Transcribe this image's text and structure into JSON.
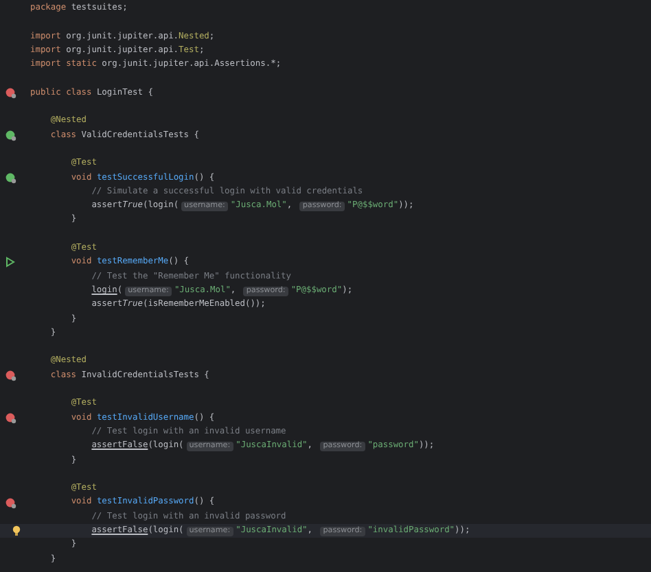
{
  "editor": {
    "lines": [
      {
        "kind": "code",
        "tokens": [
          {
            "kind": "keyword",
            "text": "package "
          },
          {
            "kind": "text",
            "text": "testsuites;"
          }
        ]
      },
      {
        "kind": "blank"
      },
      {
        "kind": "code",
        "tokens": [
          {
            "kind": "keyword",
            "text": "import "
          },
          {
            "kind": "text",
            "text": "org.junit.jupiter.api."
          },
          {
            "kind": "annotation",
            "text": "Nested"
          },
          {
            "kind": "text",
            "text": ";"
          }
        ]
      },
      {
        "kind": "code",
        "tokens": [
          {
            "kind": "keyword",
            "text": "import "
          },
          {
            "kind": "text",
            "text": "org.junit.jupiter.api."
          },
          {
            "kind": "annotation",
            "text": "Test"
          },
          {
            "kind": "text",
            "text": ";"
          }
        ]
      },
      {
        "kind": "code",
        "tokens": [
          {
            "kind": "keyword",
            "text": "import static "
          },
          {
            "kind": "text",
            "text": "org.junit.jupiter.api.Assertions.*;"
          }
        ]
      },
      {
        "kind": "blank"
      },
      {
        "kind": "code",
        "gutter": {
          "kind": "fail"
        },
        "tokens": [
          {
            "kind": "keyword",
            "text": "public class "
          },
          {
            "kind": "text",
            "text": "LoginTest {"
          }
        ]
      },
      {
        "kind": "blank"
      },
      {
        "kind": "code",
        "tokens": [
          {
            "kind": "annotation",
            "text": "    @Nested"
          }
        ]
      },
      {
        "kind": "code",
        "gutter": {
          "kind": "pass"
        },
        "tokens": [
          {
            "kind": "keyword",
            "text": "    class "
          },
          {
            "kind": "text",
            "text": "ValidCredentialsTests {"
          }
        ]
      },
      {
        "kind": "blank"
      },
      {
        "kind": "code",
        "tokens": [
          {
            "kind": "annotation",
            "text": "        @Test"
          }
        ]
      },
      {
        "kind": "code",
        "gutter": {
          "kind": "pass"
        },
        "tokens": [
          {
            "kind": "keyword",
            "text": "        void "
          },
          {
            "kind": "method",
            "text": "testSuccessfulLogin"
          },
          {
            "kind": "text",
            "text": "() {"
          }
        ]
      },
      {
        "kind": "code",
        "tokens": [
          {
            "kind": "comment",
            "text": "            // Simulate a successful login with valid credentials"
          }
        ]
      },
      {
        "kind": "code",
        "tokens": [
          {
            "kind": "text",
            "text": "            assert"
          },
          {
            "kind": "italic",
            "text": "True"
          },
          {
            "kind": "text",
            "text": "(login("
          },
          {
            "kind": "hint",
            "text": "username:"
          },
          {
            "kind": "string",
            "text": "\"Jusca.Mol\""
          },
          {
            "kind": "text",
            "text": ", "
          },
          {
            "kind": "hint",
            "text": "password:"
          },
          {
            "kind": "string",
            "text": "\"P@$$word\""
          },
          {
            "kind": "text",
            "text": "));"
          }
        ]
      },
      {
        "kind": "code",
        "tokens": [
          {
            "kind": "text",
            "text": "        }"
          }
        ]
      },
      {
        "kind": "blank"
      },
      {
        "kind": "code",
        "tokens": [
          {
            "kind": "annotation",
            "text": "        @Test"
          }
        ]
      },
      {
        "kind": "code",
        "gutter": {
          "kind": "run"
        },
        "tokens": [
          {
            "kind": "keyword",
            "text": "        void "
          },
          {
            "kind": "method",
            "text": "testRememberMe"
          },
          {
            "kind": "text",
            "text": "() {"
          }
        ]
      },
      {
        "kind": "code",
        "tokens": [
          {
            "kind": "comment",
            "text": "            // Test the \"Remember Me\" functionality"
          }
        ]
      },
      {
        "kind": "code",
        "tokens": [
          {
            "kind": "underlined",
            "text": "            login"
          },
          {
            "kind": "text",
            "text": "("
          },
          {
            "kind": "hint",
            "text": "username:"
          },
          {
            "kind": "string",
            "text": "\"Jusca.Mol\""
          },
          {
            "kind": "text",
            "text": ", "
          },
          {
            "kind": "hint",
            "text": "password:"
          },
          {
            "kind": "string",
            "text": "\"P@$$word\""
          },
          {
            "kind": "text",
            "text": ");"
          }
        ]
      },
      {
        "kind": "code",
        "tokens": [
          {
            "kind": "text",
            "text": "            assert"
          },
          {
            "kind": "italic",
            "text": "True"
          },
          {
            "kind": "text",
            "text": "(isRememberMeEnabled());"
          }
        ]
      },
      {
        "kind": "code",
        "tokens": [
          {
            "kind": "text",
            "text": "        }"
          }
        ]
      },
      {
        "kind": "code",
        "tokens": [
          {
            "kind": "text",
            "text": "    }"
          }
        ]
      },
      {
        "kind": "blank"
      },
      {
        "kind": "code",
        "tokens": [
          {
            "kind": "annotation",
            "text": "    @Nested"
          }
        ]
      },
      {
        "kind": "code",
        "gutter": {
          "kind": "fail"
        },
        "tokens": [
          {
            "kind": "keyword",
            "text": "    class "
          },
          {
            "kind": "text",
            "text": "InvalidCredentialsTests {"
          }
        ]
      },
      {
        "kind": "blank"
      },
      {
        "kind": "code",
        "tokens": [
          {
            "kind": "annotation",
            "text": "        @Test"
          }
        ]
      },
      {
        "kind": "code",
        "gutter": {
          "kind": "fail"
        },
        "tokens": [
          {
            "kind": "keyword",
            "text": "        void "
          },
          {
            "kind": "method",
            "text": "testInvalidUsername"
          },
          {
            "kind": "text",
            "text": "() {"
          }
        ]
      },
      {
        "kind": "code",
        "tokens": [
          {
            "kind": "comment",
            "text": "            // Test login with an invalid username"
          }
        ]
      },
      {
        "kind": "code",
        "tokens": [
          {
            "kind": "underlined",
            "text": "            assertFalse"
          },
          {
            "kind": "text",
            "text": "(login("
          },
          {
            "kind": "hint",
            "text": "username:"
          },
          {
            "kind": "string",
            "text": "\"JuscaInvalid\""
          },
          {
            "kind": "text",
            "text": ", "
          },
          {
            "kind": "hint",
            "text": "password:"
          },
          {
            "kind": "string",
            "text": "\"password\""
          },
          {
            "kind": "text",
            "text": "));"
          }
        ]
      },
      {
        "kind": "code",
        "tokens": [
          {
            "kind": "text",
            "text": "        }"
          }
        ]
      },
      {
        "kind": "blank"
      },
      {
        "kind": "code",
        "tokens": [
          {
            "kind": "annotation",
            "text": "        @Test"
          }
        ]
      },
      {
        "kind": "code",
        "gutter": {
          "kind": "fail"
        },
        "tokens": [
          {
            "kind": "keyword",
            "text": "        void "
          },
          {
            "kind": "method",
            "text": "testInvalidPassword"
          },
          {
            "kind": "text",
            "text": "() {"
          }
        ]
      },
      {
        "kind": "code",
        "tokens": [
          {
            "kind": "comment",
            "text": "            // Test login with an invalid password"
          }
        ]
      },
      {
        "kind": "code",
        "gutter": {
          "kind": "bulb"
        },
        "current": true,
        "tokens": [
          {
            "kind": "underlined",
            "text": "            assertFalse"
          },
          {
            "kind": "text",
            "text": "(login("
          },
          {
            "kind": "hint",
            "text": "username:"
          },
          {
            "kind": "string",
            "text": "\"JuscaInvalid\""
          },
          {
            "kind": "text",
            "text": ", "
          },
          {
            "kind": "hint",
            "text": "password:"
          },
          {
            "kind": "string",
            "text": "\"invalidPassword\""
          },
          {
            "kind": "text",
            "text": "));"
          }
        ]
      },
      {
        "kind": "code",
        "tokens": [
          {
            "kind": "text",
            "text": "        }"
          }
        ]
      },
      {
        "kind": "code",
        "tokens": [
          {
            "kind": "text",
            "text": "    }"
          }
        ]
      }
    ]
  }
}
